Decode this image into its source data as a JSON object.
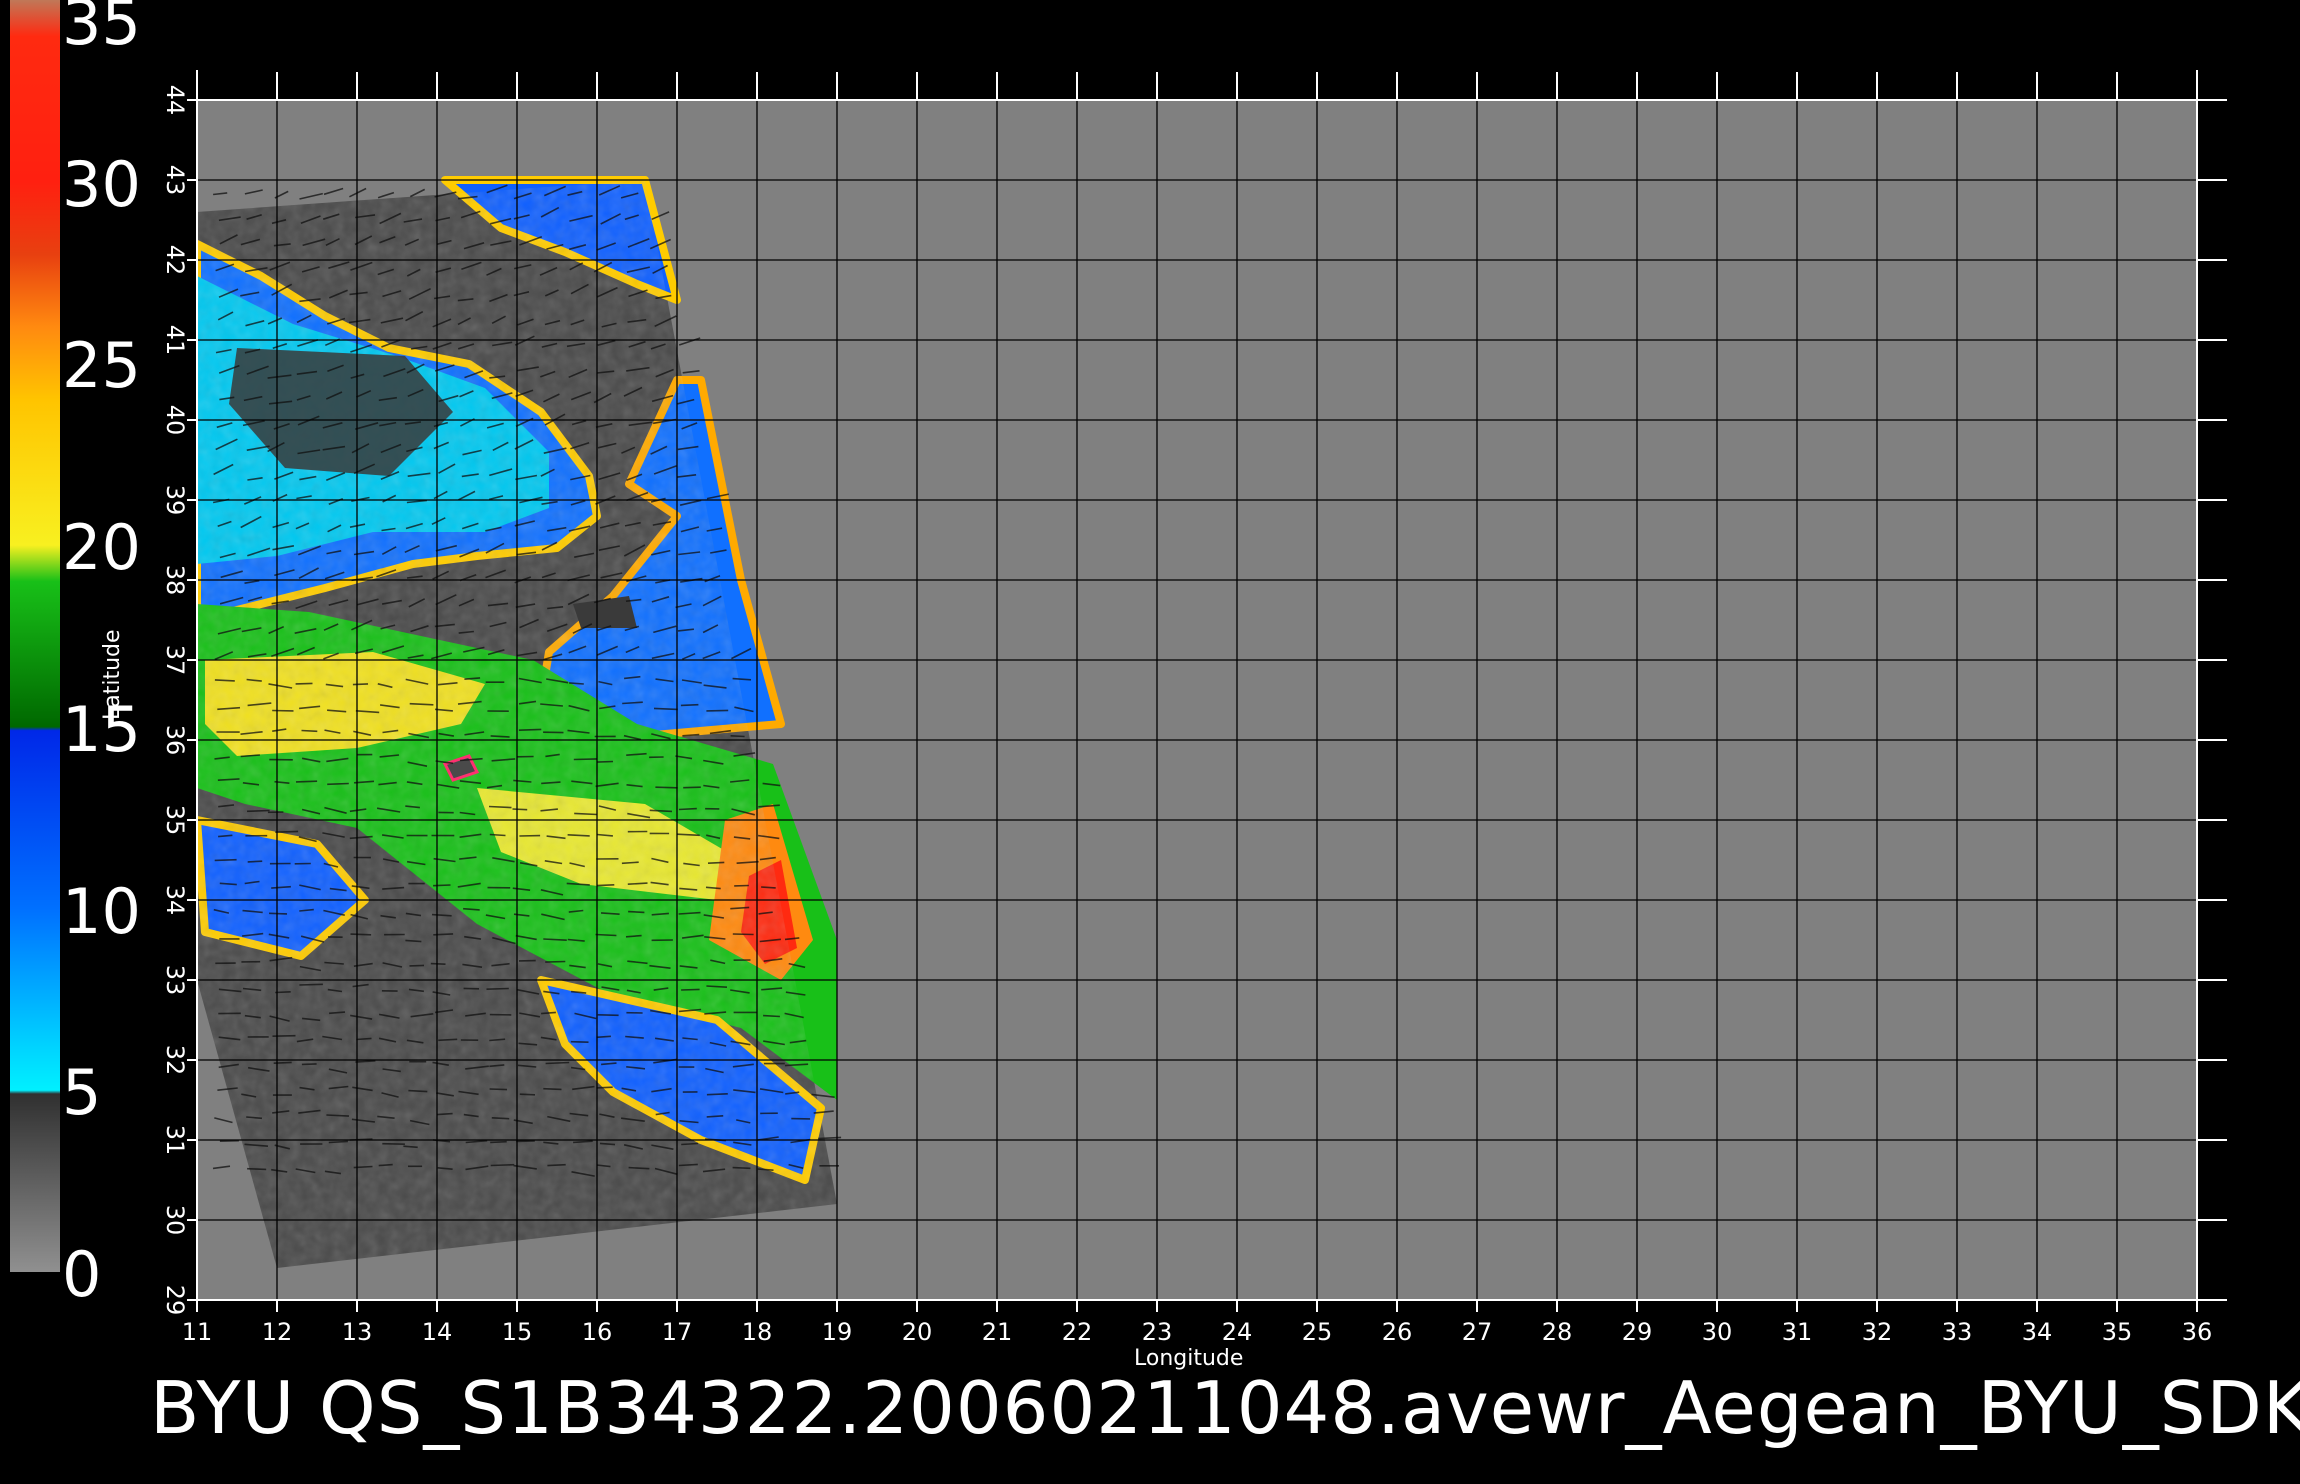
{
  "colorbar": {
    "labels": [
      "35",
      "30",
      "25",
      "20",
      "15",
      "10",
      "5",
      "0"
    ],
    "stops": [
      {
        "value": 35,
        "color": "#c07858"
      },
      {
        "value": 34,
        "color": "#ff2a10"
      },
      {
        "value": 30,
        "color": "#ff2010"
      },
      {
        "value": 28,
        "color": "#e84010"
      },
      {
        "value": 26,
        "color": "#ff8a10"
      },
      {
        "value": 24,
        "color": "#ffc400"
      },
      {
        "value": 20,
        "color": "#f8f020"
      },
      {
        "value": 19,
        "color": "#18c018"
      },
      {
        "value": 15,
        "color": "#006800"
      },
      {
        "value": 14.9,
        "color": "#0028e8"
      },
      {
        "value": 10,
        "color": "#0070ff"
      },
      {
        "value": 6,
        "color": "#00d8ff"
      },
      {
        "value": 5,
        "color": "#00f0ff"
      },
      {
        "value": 4.9,
        "color": "#303030"
      },
      {
        "value": 0,
        "color": "#909090"
      }
    ]
  },
  "map": {
    "xlabel": "Longitude",
    "ylabel": "Latitude",
    "lon_ticks": [
      "11",
      "12",
      "13",
      "14",
      "15",
      "16",
      "17",
      "18",
      "19",
      "20",
      "21",
      "22",
      "23",
      "24",
      "25",
      "26",
      "27",
      "28",
      "29",
      "30",
      "31",
      "32",
      "33",
      "34",
      "35",
      "36"
    ],
    "lat_ticks": [
      "29",
      "30",
      "31",
      "32",
      "33",
      "34",
      "35",
      "36",
      "37",
      "38",
      "39",
      "40",
      "41",
      "42",
      "43",
      "44"
    ],
    "lon_range": [
      11,
      36
    ],
    "lat_range": [
      29,
      44
    ],
    "background_color": "#808080",
    "land_color": "#4a4a4a",
    "grid_color": "#000000"
  },
  "footer": {
    "title": "BYU  QS_S1B34322.20060211048.avewr_Aegean_BYU_SDK"
  }
}
